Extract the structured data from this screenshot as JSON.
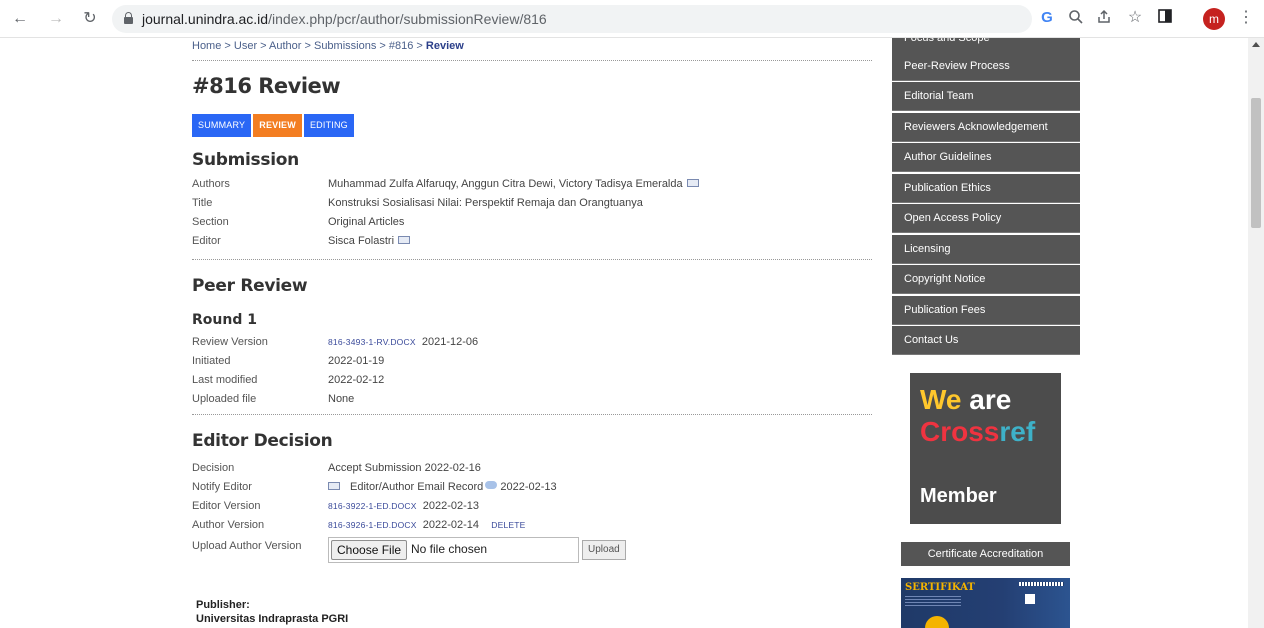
{
  "browser": {
    "url_host": "journal.unindra.ac.id",
    "url_path": "/index.php/pcr/author/submissionReview/816",
    "avatar_letter": "m",
    "icons": [
      "back-icon",
      "forward-icon",
      "reload-icon",
      "lock-icon",
      "google-icon",
      "zoom-icon",
      "share-icon",
      "star-icon",
      "sidebar-icon",
      "menu-icon"
    ]
  },
  "breadcrumb": {
    "path": "Home > User > Author > Submissions > #816 > ",
    "current": "Review"
  },
  "page_title": "#816 Review",
  "tabs": [
    {
      "label": "SUMMARY",
      "color": "#2a67f5"
    },
    {
      "label": "REVIEW",
      "color": "#f37e22"
    },
    {
      "label": "EDITING",
      "color": "#2a67f5"
    }
  ],
  "submission": {
    "heading": "Submission",
    "authors_label": "Authors",
    "authors": "Muhammad Zulfa Alfaruqy, Anggun Citra Dewi, Victory Tadisya Emeralda",
    "title_label": "Title",
    "title": "Konstruksi Sosialisasi Nilai: Perspektif Remaja dan Orangtuanya",
    "section_label": "Section",
    "section": "Original Articles",
    "editor_label": "Editor",
    "editor": "Sisca Folastri"
  },
  "peer_review": {
    "heading": "Peer Review",
    "round": "Round 1",
    "review_version_label": "Review Version",
    "review_version_file": "816-3493-1-RV.DOCX",
    "review_version_date": "2021-12-06",
    "initiated_label": "Initiated",
    "initiated": "2022-01-19",
    "last_modified_label": "Last modified",
    "last_modified": "2022-02-12",
    "uploaded_file_label": "Uploaded file",
    "uploaded_file": "None"
  },
  "editor_decision": {
    "heading": "Editor Decision",
    "decision_label": "Decision",
    "decision": "Accept Submission 2022-02-16",
    "notify_label": "Notify Editor",
    "notify_record": "Editor/Author Email Record",
    "notify_date": "2022-02-13",
    "editor_version_label": "Editor Version",
    "editor_version_file": "816-3922-1-ED.DOCX",
    "editor_version_date": "2022-02-13",
    "author_version_label": "Author Version",
    "author_version_file": "816-3926-1-ED.DOCX",
    "author_version_date": "2022-02-14",
    "delete_label": "DELETE",
    "upload_label": "Upload Author Version",
    "choose_file": "Choose File",
    "no_file": "No file chosen",
    "upload_button": "Upload"
  },
  "publisher": {
    "label": "Publisher:",
    "name": "Universitas Indraprasta PGRI"
  },
  "sidebar": {
    "items": [
      "Focus and Scope",
      "Peer-Review Process",
      "Editorial Team",
      "Reviewers Acknowledgement",
      "Author Guidelines",
      "Publication Ethics",
      "Open Access Policy",
      "Licensing",
      "Copyright Notice",
      "Publication Fees",
      "Contact Us"
    ],
    "crossref": {
      "we": "We",
      "are": "are",
      "cross": "Cross",
      "ref": "ref",
      "member": "Member"
    },
    "certificate_button": "Certificate Accreditation",
    "certificate_title": "SERTIFIKAT"
  }
}
